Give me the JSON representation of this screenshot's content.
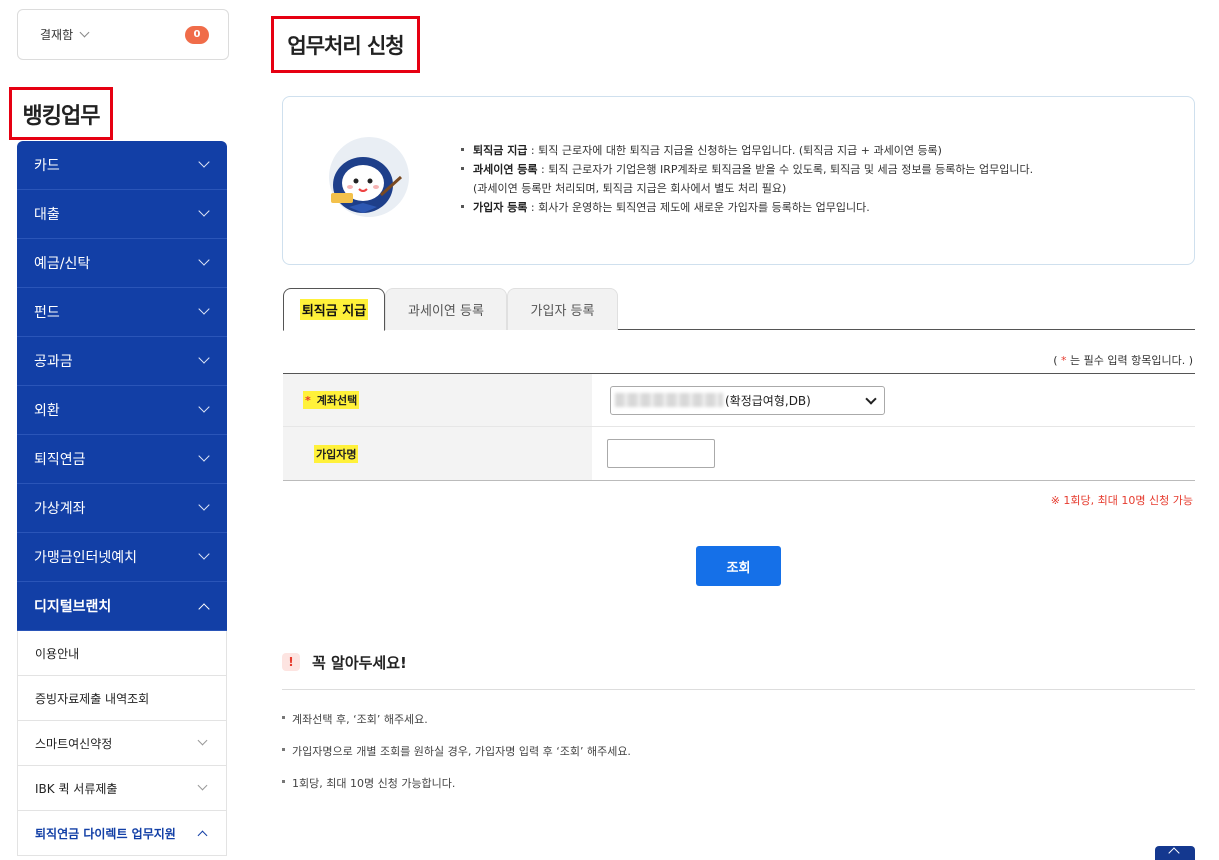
{
  "approval": {
    "label": "결재함",
    "count": "0"
  },
  "sidebar": {
    "title": "뱅킹업무",
    "items": [
      {
        "label": "카드"
      },
      {
        "label": "대출"
      },
      {
        "label": "예금/신탁"
      },
      {
        "label": "펀드"
      },
      {
        "label": "공과금"
      },
      {
        "label": "외환"
      },
      {
        "label": "퇴직연금"
      },
      {
        "label": "가상계좌"
      },
      {
        "label": "가맹금인터넷예치"
      },
      {
        "label": "디지털브랜치"
      }
    ],
    "subitems": [
      {
        "label": "이용안내"
      },
      {
        "label": "증빙자료제출 내역조회"
      },
      {
        "label": "스마트여신약정"
      },
      {
        "label": "IBK 퀵 서류제출"
      },
      {
        "label": "퇴직연금 다이렉트 업무지원"
      }
    ]
  },
  "page": {
    "title": "업무처리 신청"
  },
  "info": {
    "line1_bold": "퇴직금 지급",
    "line1_text": " : 퇴직 근로자에 대한 퇴직금 지급을 신청하는 업무입니다. (퇴직금 지급 + 과세이연 등록)",
    "line2_bold": "과세이연 등록",
    "line2_text": " : 퇴직 근로자가 기업은행 IRP계좌로 퇴직금을 받을 수 있도록, 퇴직금 및 세금 정보를 등록하는 업무입니다.",
    "line3_text": "(과세이연 등록만 처리되며, 퇴직금 지급은 회사에서 별도 처리 필요)",
    "line4_bold": "가입자 등록",
    "line4_text": " : 회사가 운영하는 퇴직연금 제도에 새로운 가입자를 등록하는 업무입니다."
  },
  "tabs": [
    {
      "label": "퇴직금 지급"
    },
    {
      "label": "과세이연 등록"
    },
    {
      "label": "가입자 등록"
    }
  ],
  "required_note": {
    "open": "( ",
    "star": "*",
    "text": " 는 필수 입력 항목입니다. )"
  },
  "form": {
    "account_star": "*",
    "account_label": "계좌선택",
    "account_value": "(확정급여형,DB)",
    "name_label": "가입자명",
    "name_value": ""
  },
  "limit_note": "※ 1회당, 최대 10명 신청 가능",
  "search_button": "조회",
  "notice": {
    "icon": "!",
    "title": "꼭 알아두세요!",
    "items": [
      "계좌선택 후, ‘조회’ 해주세요.",
      "가입자명으로 개별 조회를 원하실 경우, 가입자명 입력 후 ‘조회’ 해주세요.",
      "1회당, 최대 10명 신청 가능합니다."
    ]
  },
  "colors": {
    "nav": "#123fa6",
    "accent": "#1570e8",
    "highlight": "#fff13a",
    "alert": "#e63b2e",
    "badge": "#f06c49"
  }
}
